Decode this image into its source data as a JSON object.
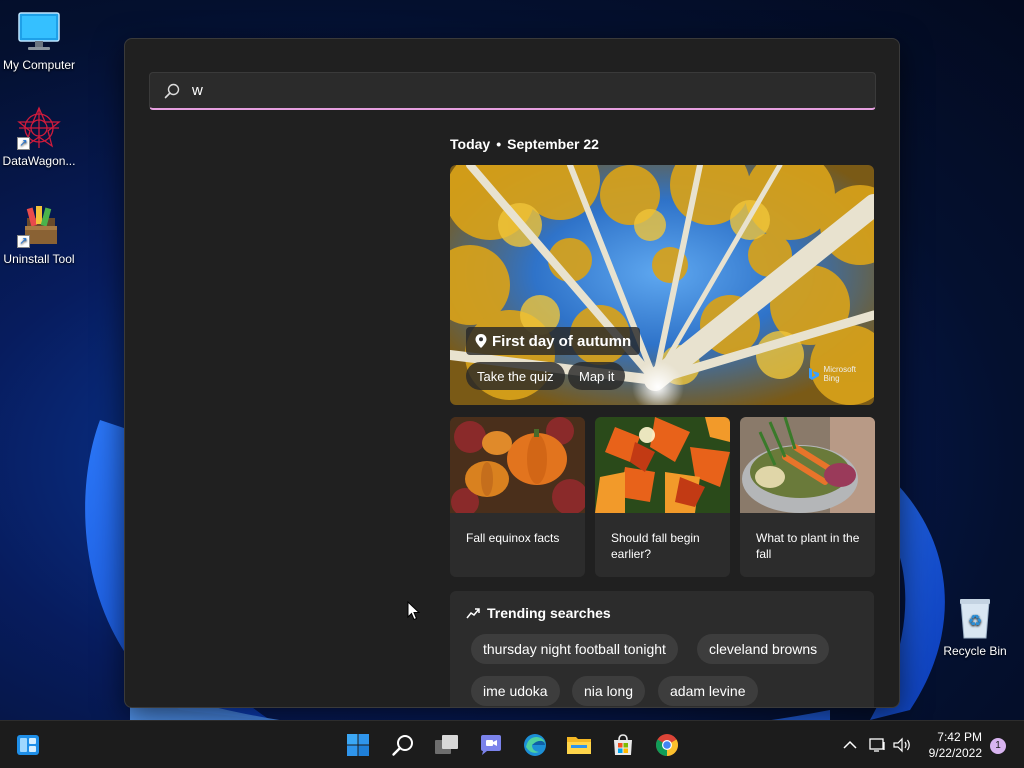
{
  "desktop": {
    "icons": [
      {
        "label": "My Computer",
        "icon": "monitor-icon"
      },
      {
        "label": "DataWagon...",
        "icon": "datawagon-icon"
      },
      {
        "label": "Uninstall Tool",
        "icon": "uninstall-tool-icon"
      },
      {
        "label": "Recycle Bin",
        "icon": "recycle-bin-icon"
      }
    ]
  },
  "search": {
    "query": "w",
    "date_prefix": "Today",
    "date": "September 22",
    "hero": {
      "title": "First day of autumn",
      "buttons": [
        "Take the quiz",
        "Map it"
      ],
      "brand": [
        "Microsoft",
        "Bing"
      ]
    },
    "cards": [
      {
        "label": "Fall equinox facts"
      },
      {
        "label": "Should fall begin earlier?"
      },
      {
        "label": "What to plant in the fall"
      }
    ],
    "trending": {
      "title": "Trending searches",
      "items": [
        "thursday night football tonight",
        "cleveland browns",
        "ime udoka",
        "nia long",
        "adam levine"
      ]
    }
  },
  "taskbar": {
    "apps": [
      "widgets-icon",
      "start-icon",
      "search-icon",
      "task-view-icon",
      "teams-chat-icon",
      "edge-icon",
      "file-explorer-icon",
      "store-icon",
      "chrome-icon"
    ],
    "time": "7:42 PM",
    "date": "9/22/2022",
    "notification_count": "1"
  },
  "colors": {
    "accent_underline": "#e6a0e0",
    "panel_bg": "#202020",
    "card_bg": "#2c2c2c",
    "chip_bg": "#3d3d3d",
    "badge": "#d8b4f0"
  }
}
